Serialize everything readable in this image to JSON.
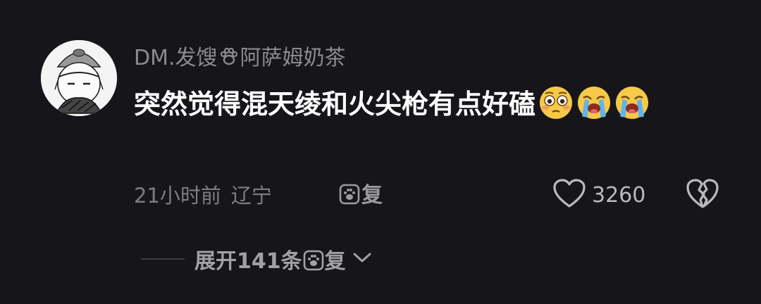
{
  "comment": {
    "username_prefix": "DM.发馊",
    "username_suffix": "阿萨姆奶茶",
    "text": "突然觉得混天绫和火尖枪有点好磕",
    "emojis": [
      "flushed-face-emoji",
      "loudly-crying-face-emoji",
      "loudly-crying-face-emoji"
    ],
    "time": "21小时前",
    "location": "辽宁",
    "reply_label": "复",
    "like_count": "3260",
    "expand_prefix": "展开141条",
    "expand_suffix": "复"
  },
  "icons": {
    "inline_icon": "paw-icon",
    "like": "heart-outline-icon",
    "dislike": "broken-heart-icon",
    "expand": "chevron-down-icon"
  },
  "colors": {
    "background": "#16161a",
    "primary_text": "#ffffff",
    "secondary_text": "#8a8a8f"
  }
}
